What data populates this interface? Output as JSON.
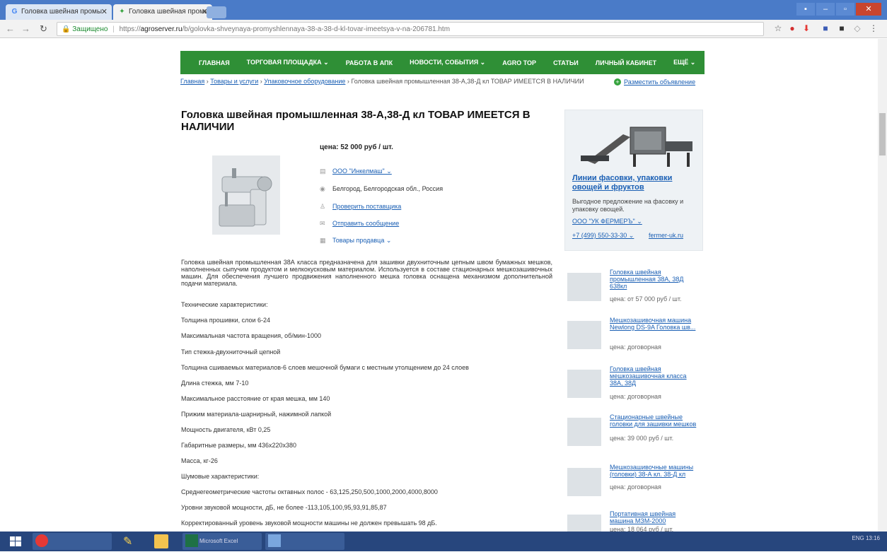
{
  "browser": {
    "tabs": [
      {
        "label": "Головка швейная промы"
      },
      {
        "label": "Головка швейная промы"
      }
    ],
    "secure_label": "Защищено",
    "url_scheme": "https://",
    "url_host": "agroserver.ru",
    "url_path": "/b/golovka-shveynaya-promyshlennaya-38-a-38-d-kl-tovar-imeetsya-v-na-206781.htm"
  },
  "site": {
    "nav": [
      "ГЛАВНАЯ",
      "ТОРГОВАЯ ПЛОЩАДКА ⌄",
      "РАБОТА В АПК",
      "НОВОСТИ, СОБЫТИЯ ⌄",
      "AGRO TOP",
      "СТАТЬИ",
      "ЛИЧНЫЙ КАБИНЕТ",
      "ЕЩЁ ⌄"
    ],
    "breadcrumbs": {
      "home": "Главная",
      "cat1": "Товары и услуги",
      "cat2": "Упаковочное оборудование",
      "current": "Головка швейная промышленная 38-А,38-Д кл ТОВАР ИМЕЕТСЯ В НАЛИЧИИ",
      "sep": "›"
    },
    "post_ad": "Разместить объявление"
  },
  "product": {
    "title": "Головка швейная промышленная 38-А,38-Д кл ТОВАР ИМЕЕТСЯ В НАЛИЧИИ",
    "price": "цена: 52 000 руб / шт.",
    "company": "ООО \"Инкелмаш\" ⌄",
    "location": "Белгород, Белгородская обл., Россия",
    "check_supplier": "Проверить поставщика",
    "send_message": "Отправить сообщение",
    "seller_goods": "Товары продавца ⌄",
    "description": "Головка швейная промышленная 38А класса предназначена для зашивки двухниточным цепным швом бумажных мешков, наполненных сыпучим продуктом и мелкокусковым материалом. Используется в составе стационарных мешкозашивочных машин. Для обеспечения лучшего продвижения наполненного мешка головка оснащена механизмом дополнительной подачи материала.",
    "specs": [
      "Технические характеристики:",
      "Толщина прошивки, слои 6-24",
      "Максимальная частота вращения, об/мин-1000",
      "Тип стежка-двухниточный цепной",
      "Толщина сшиваемых материалов-6 слоев мешочной бумаги с местным утолщением до 24 слоев",
      "Длина стежка, мм 7-10",
      "Максимальное расстояние от края мешка, мм 140",
      "Прижим материала-шарнирный, нажимной лапкой",
      "Мощность двигателя, кВт 0,25",
      "Габаритные размеры, мм 436х220х380",
      "Масса, кг-26",
      "Шумовые характеристики:",
      "Среднегеометрические частоты октавных полос - 63,125,250,500,1000,2000,4000,8000",
      "Уровни звуковой мощности, дБ, не более -113,105,100,95,93,91,85,87",
      "Корректированный уровень звуковой мощности машины не должен превышать 98 дБ."
    ]
  },
  "ad": {
    "title": "Линии фасовки, упаковки овощей и фруктов",
    "desc": "Выгодное предложение на фасовку и упаковку овощей.",
    "company": "ООО \"УК ФЕРМЕРЪ\" ⌄",
    "phone": "+7 (499) 550-33-30 ⌄",
    "site": "fermer-uk.ru"
  },
  "related": [
    {
      "title": "Головка швейная промышленная 38А, 38Д 638кл",
      "price": "цена: от 57 000 руб / шт."
    },
    {
      "title": "Мешкозашивочная машина Newlong DS-9A Головка шв...",
      "price": "цена: договорная"
    },
    {
      "title": "Головка швейная мешкозашивочная класса 38А, 38Д",
      "price": "цена: договорная"
    },
    {
      "title": "Стационарные швейные головки для зашивки мешков",
      "price": "цена: 39 000 руб / шт."
    },
    {
      "title": "Мешкозашивочные машины (головки) 38-А кл. 38-Д кл",
      "price": "цена: договорная"
    },
    {
      "title": "Портативная швейная машина МЗМ-2000",
      "price": "цена: 18 064 руб / шт."
    }
  ],
  "taskbar": {
    "apps": [
      "",
      "Microsoft Excel",
      ""
    ],
    "tray_lang": "ENG",
    "time": "13:16"
  }
}
